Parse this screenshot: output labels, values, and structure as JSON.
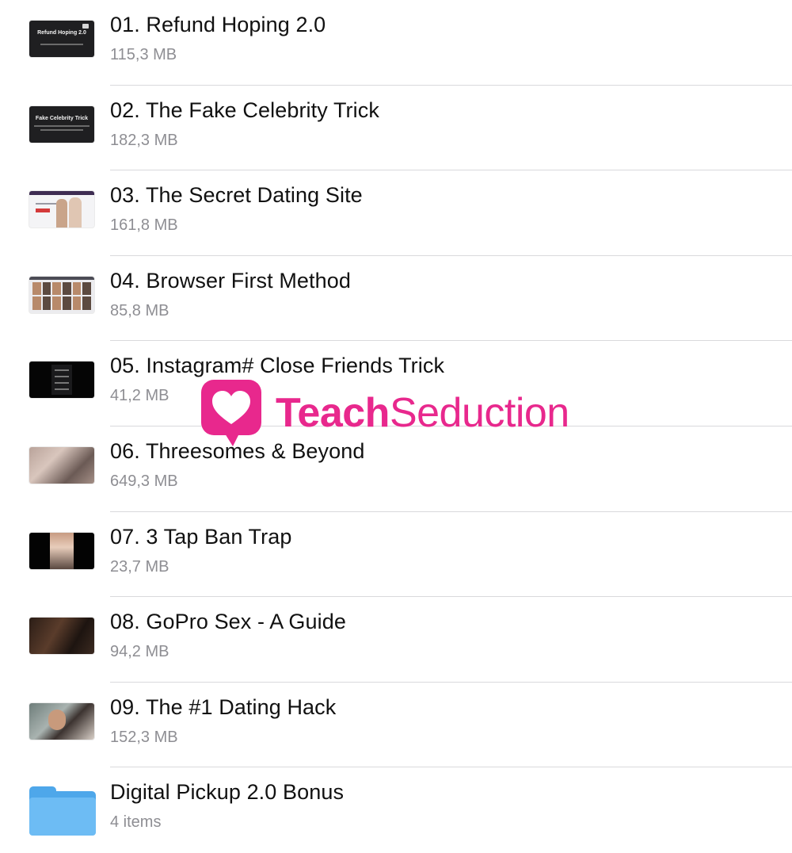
{
  "files": [
    {
      "title": "01. Refund Hoping 2.0",
      "meta": "115,3 MB",
      "thumb_text": "Refund Hoping 2.0",
      "thumb": "slide-thumbnail"
    },
    {
      "title": "02. The Fake Celebrity Trick",
      "meta": "182,3 MB",
      "thumb_text": "Fake Celebrity Trick",
      "thumb": "slide-thumbnail"
    },
    {
      "title": "03. The Secret Dating Site",
      "meta": "161,8 MB",
      "thumb": "website-thumbnail"
    },
    {
      "title": "04. Browser First Method",
      "meta": "85,8 MB",
      "thumb": "photo-grid-thumbnail"
    },
    {
      "title": "05. Instagram# Close Friends Trick",
      "meta": "41,2 MB",
      "thumb": "phone-screen-thumbnail"
    },
    {
      "title": "06. Threesomes & Beyond",
      "meta": "649,3 MB",
      "thumb": "video-thumbnail"
    },
    {
      "title": "07. 3 Tap Ban Trap",
      "meta": "23,7 MB",
      "thumb": "video-thumbnail"
    },
    {
      "title": "08. GoPro Sex - A Guide",
      "meta": "94,2 MB",
      "thumb": "video-thumbnail"
    },
    {
      "title": "09. The #1 Dating Hack",
      "meta": "152,3 MB",
      "thumb": "video-thumbnail"
    },
    {
      "title": "Digital Pickup 2.0 Bonus",
      "meta": "4 items",
      "thumb": "folder-icon"
    }
  ],
  "watermark": {
    "brand_bold": "Teach",
    "brand_regular": "Seduction",
    "icon": "heart-speech-bubble-icon",
    "color": "#e8288d"
  },
  "colors": {
    "title_text": "#111111",
    "meta_text": "#8e8e93",
    "divider": "#d9d9dc",
    "folder_blue": "#6dbcf4"
  }
}
